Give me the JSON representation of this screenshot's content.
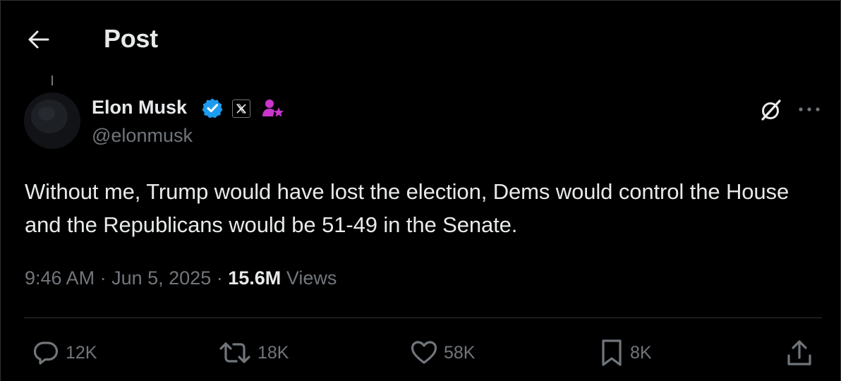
{
  "header": {
    "title": "Post"
  },
  "author": {
    "name": "Elon Musk",
    "handle": "@elonmusk",
    "verified_color": "#1d9bf0",
    "subscriber_color": "#c936cc"
  },
  "post": {
    "text": "Without me, Trump would have lost the election, Dems would control the House and the Republicans would be 51-49 in the Senate.",
    "time": "9:46 AM",
    "separator": "·",
    "date": "Jun 5, 2025",
    "views_count": "15.6M",
    "views_label": "Views"
  },
  "actions": {
    "replies": "12K",
    "reposts": "18K",
    "likes": "58K",
    "bookmarks": "8K"
  },
  "icons": {
    "back": "arrow-left-icon",
    "verified": "verified-badge-icon",
    "affiliate": "x-logo-icon",
    "subscriber": "subscriber-star-icon",
    "grok": "grok-icon",
    "more": "more-dots-icon",
    "reply": "reply-icon",
    "repost": "repost-icon",
    "like": "heart-icon",
    "bookmark": "bookmark-icon",
    "share": "share-icon"
  },
  "colors": {
    "background": "#000000",
    "text_primary": "#e7e9ea",
    "text_secondary": "#71767b",
    "border": "#2f3336"
  }
}
